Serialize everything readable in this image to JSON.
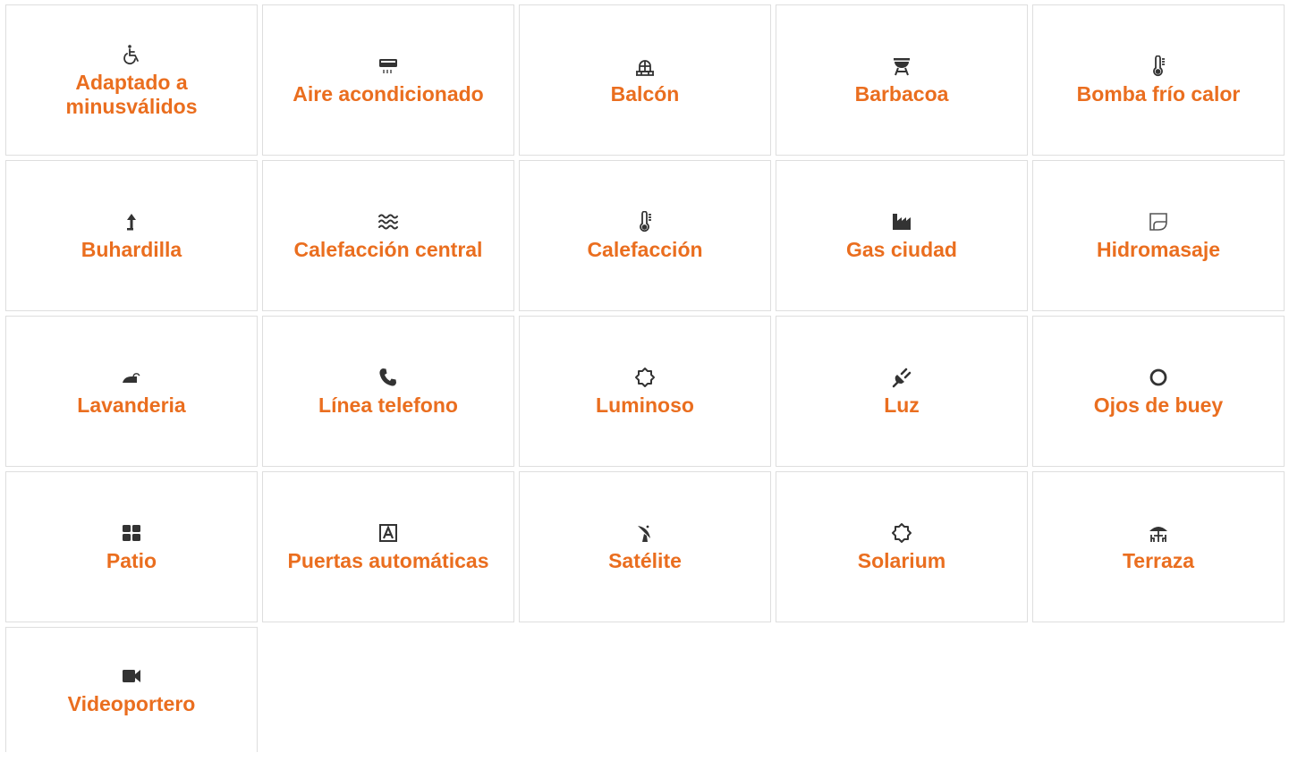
{
  "accent_color": "#ea6e1f",
  "features": [
    {
      "label": "Adaptado a minusválidos",
      "icon": "wheelchair-icon"
    },
    {
      "label": "Aire acondicionado",
      "icon": "air-conditioner-icon"
    },
    {
      "label": "Balcón",
      "icon": "balcony-icon"
    },
    {
      "label": "Barbacoa",
      "icon": "barbecue-icon"
    },
    {
      "label": "Bomba frío calor",
      "icon": "thermometer-icon"
    },
    {
      "label": "Buhardilla",
      "icon": "arrow-up-icon"
    },
    {
      "label": "Calefacción central",
      "icon": "heat-waves-icon"
    },
    {
      "label": "Calefacción",
      "icon": "thermometer-icon"
    },
    {
      "label": "Gas ciudad",
      "icon": "factory-icon"
    },
    {
      "label": "Hidromasaje",
      "icon": "bathtub-icon"
    },
    {
      "label": "Lavanderia",
      "icon": "iron-icon"
    },
    {
      "label": "Línea telefono",
      "icon": "phone-icon"
    },
    {
      "label": "Luminoso",
      "icon": "sun-icon"
    },
    {
      "label": "Luz",
      "icon": "plug-icon"
    },
    {
      "label": "Ojos de buey",
      "icon": "circle-icon"
    },
    {
      "label": "Patio",
      "icon": "tiles-icon"
    },
    {
      "label": "Puertas automáticas",
      "icon": "automatic-door-icon"
    },
    {
      "label": "Satélite",
      "icon": "satellite-dish-icon"
    },
    {
      "label": "Solarium",
      "icon": "sun-icon"
    },
    {
      "label": "Terraza",
      "icon": "terrace-umbrella-icon"
    },
    {
      "label": "Videoportero",
      "icon": "video-camera-icon"
    }
  ]
}
